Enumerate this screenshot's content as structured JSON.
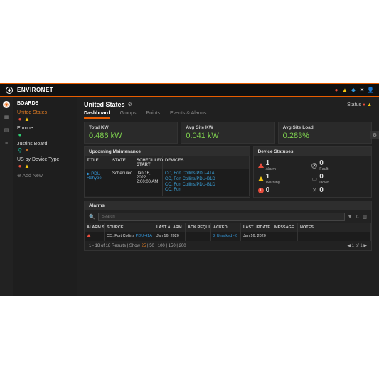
{
  "brand": "ENVIRONET",
  "sidebar": {
    "title": "BOARDS",
    "items": [
      {
        "name": "United States",
        "nameClass": "orange"
      },
      {
        "name": "Europe"
      },
      {
        "name": "Justins Board"
      },
      {
        "name": "US by Device Type"
      }
    ],
    "addNew": "Add New"
  },
  "page": {
    "title": "United States",
    "statusLabel": "Status"
  },
  "tabs": [
    "Dashboard",
    "Groups",
    "Points",
    "Events & Alarms"
  ],
  "metrics": [
    {
      "label": "Total KW",
      "value": "0.486 kW"
    },
    {
      "label": "Avg Site KW",
      "value": "0.041 kW"
    },
    {
      "label": "Avg Site Load",
      "value": "0.283%"
    }
  ],
  "maintenance": {
    "title": "Upcoming Maintenance",
    "columns": {
      "title": "TITLE",
      "state": "STATE",
      "start": "SCHEDULED START",
      "devices": "DEVICES"
    },
    "row": {
      "title": "PDU Rehype",
      "state": "Scheduled",
      "start": "Jan 16, 2022 2:00:00 AM",
      "devices": [
        "CO, Fort Collins/PDU-41A",
        "CO, Fort Collins/PDU-B1D",
        "CO, Fort Collins/PDU-B1D",
        "CO, Fort"
      ]
    }
  },
  "deviceStatuses": {
    "title": "Device Statuses",
    "items": [
      {
        "label": "Alarm",
        "value": "1"
      },
      {
        "label": "Fault",
        "value": "0"
      },
      {
        "label": "Warning",
        "value": "1"
      },
      {
        "label": "Down",
        "value": "0"
      },
      {
        "label": "",
        "value": "0"
      },
      {
        "label": "",
        "value": "0"
      }
    ]
  },
  "alarms": {
    "title": "Alarms",
    "searchPlaceholder": "Search",
    "columns": {
      "state": "ALARM STATE",
      "source": "SOURCE",
      "last": "LAST ALARM",
      "ack": "ACK REQUIRED",
      "acked": "ACKED",
      "update": "LAST UPDATE",
      "msg": "MESSAGE",
      "notes": "NOTES"
    },
    "row": {
      "source": "CO, Fort Collins",
      "sourceLink": "PDU-41A",
      "last": "Jan 16, 2020",
      "ack": "",
      "acked": "2 Unacked - 0",
      "update": "Jan 16, 2020",
      "msg": "",
      "notes": ""
    },
    "footer": {
      "prefix": "1 - 18 of 18 Results | Show",
      "active": "25",
      "rest": "| 50 | 100 | 150 | 200",
      "page": "of 1"
    }
  }
}
